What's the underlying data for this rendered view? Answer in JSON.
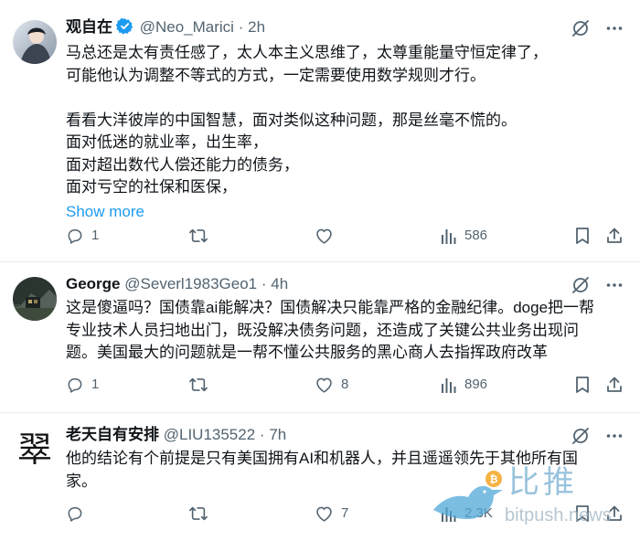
{
  "posts": [
    {
      "author": "观自在",
      "handle": "@Neo_Marici",
      "sep": "·",
      "time": "2h",
      "verified": true,
      "lines": [
        "马总还是太有责任感了，太人本主义思维了，太尊重能量守恒定律了，",
        "可能他认为调整不等式的方式，一定需要使用数学规则才行。",
        "",
        "看看大洋彼岸的中国智慧，面对类似这种问题，那是丝毫不慌的。",
        "面对低迷的就业率，出生率，",
        "面对超出数代人偿还能力的债务，",
        "面对亏空的社保和医保，"
      ],
      "show_more": "Show more",
      "replies": "1",
      "reposts": "",
      "likes": "",
      "views": "586"
    },
    {
      "author": "George",
      "handle": "@Severl1983Geo1",
      "sep": "·",
      "time": "4h",
      "verified": false,
      "lines": [
        "这是傻逼吗？国债靠ai能解决？国债解决只能靠严格的金融纪律。doge把一帮",
        "专业技术人员扫地出门，既没解决债务问题，还造成了关键公共业务出现问",
        "题。美国最大的问题就是一帮不懂公共服务的黑心商人去指挥政府改革"
      ],
      "replies": "1",
      "reposts": "",
      "likes": "8",
      "views": "896"
    },
    {
      "author": "老天自有安排",
      "handle": "@LIU135522",
      "sep": "·",
      "time": "7h",
      "verified": false,
      "avatar_char": "翠",
      "lines": [
        "他的结论有个前提是只有美国拥有AI和机器人，并且遥遥领先于其他所有国",
        "家。"
      ],
      "replies": "",
      "reposts": "",
      "likes": "7",
      "views": "2.3K"
    }
  ],
  "watermark": {
    "cn": "比推",
    "en": "bitpush.news"
  },
  "colors": {
    "accent": "#1d9bf0",
    "muted": "#536471",
    "text": "#0f1419",
    "divider": "#e6ecf0"
  },
  "icons": [
    "verified-badge-icon",
    "grok-slash-icon",
    "more-icon",
    "reply-icon",
    "repost-icon",
    "like-icon",
    "views-icon",
    "bookmark-icon",
    "share-icon"
  ]
}
